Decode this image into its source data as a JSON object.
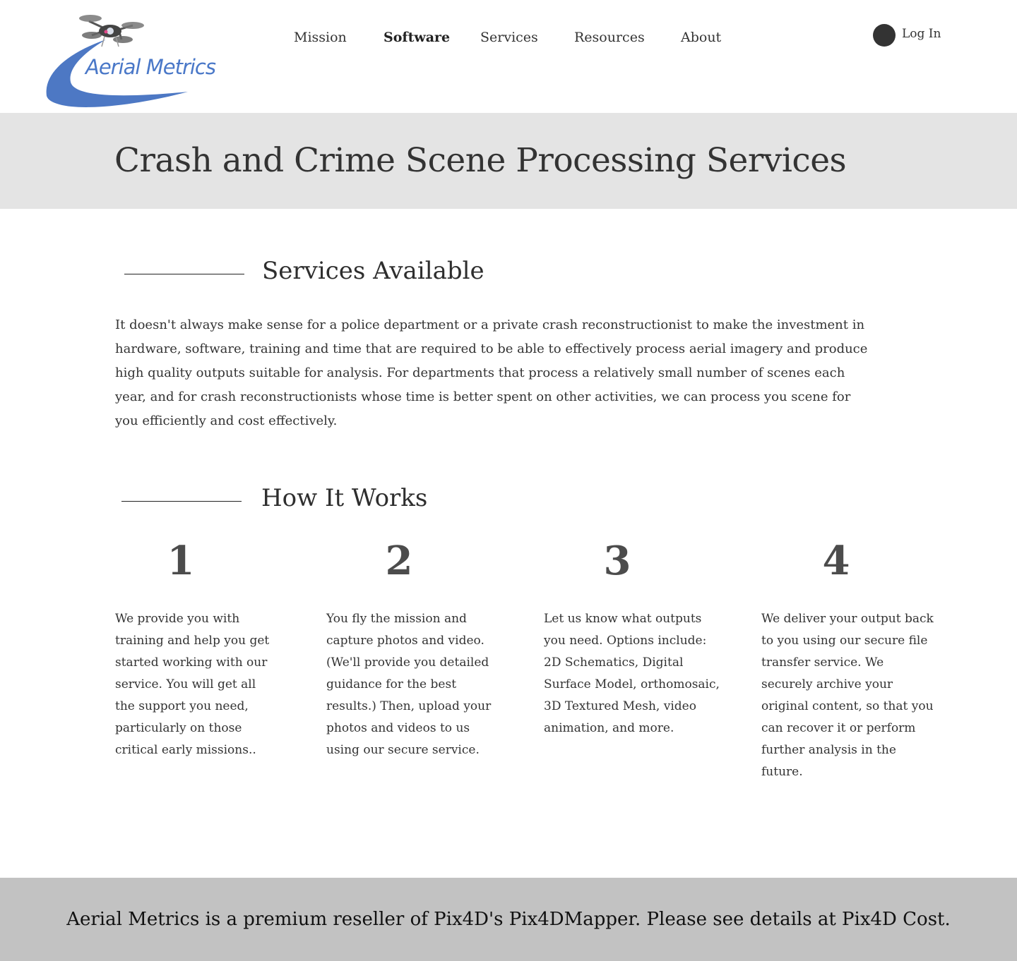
{
  "header": {
    "logo_text": "Aerial Metrics",
    "nav": [
      {
        "label": "Mission"
      },
      {
        "label": "Software",
        "active": true
      },
      {
        "label": "Services"
      },
      {
        "label": "Resources"
      },
      {
        "label": "About"
      }
    ],
    "login_label": "Log In",
    "login_icon": "user-avatar-icon"
  },
  "title": "Crash and Crime Scene Processing Services",
  "services": {
    "heading": "Services Available",
    "body": "It doesn't always make sense for a police department or a private crash reconstructionist to make the investment in hardware, software, training and time that are required to be able to effectively process aerial imagery and produce high quality outputs suitable for analysis.  For departments that process a relatively small number of scenes each year, and for crash reconstructionists whose time is better spent on other activities, we can process you scene for you efficiently and cost effectively."
  },
  "how": {
    "heading": "How It Works",
    "steps": [
      {
        "number": "1",
        "text": "We provide you with training and help you get started working with our service. You will get all the support you need, particularly on those critical early missions.."
      },
      {
        "number": "2",
        "text": "You fly the mission and capture photos and video. (We'll provide you detailed guidance for the best results.) Then, upload your photos and videos to us using our secure service."
      },
      {
        "number": "3",
        "text": "Let us know what outputs you need. Options include: 2D Schematics, Digital Surface Model, orthomosaic, 3D Textured Mesh, video animation, and more."
      },
      {
        "number": "4",
        "text": "We deliver your output back to you using our secure file transfer service. We securely archive your original content, so that you can recover it or perform further analysis in the future."
      }
    ]
  },
  "footer": {
    "text": "Aerial Metrics is a premium reseller of Pix4D's Pix4DMapper.  Please see details at Pix4D Cost."
  },
  "colors": {
    "brand_blue": "#4a78c8",
    "title_band": "#e4e4e4",
    "footer_band": "#c2c2c2",
    "text": "#333333"
  }
}
